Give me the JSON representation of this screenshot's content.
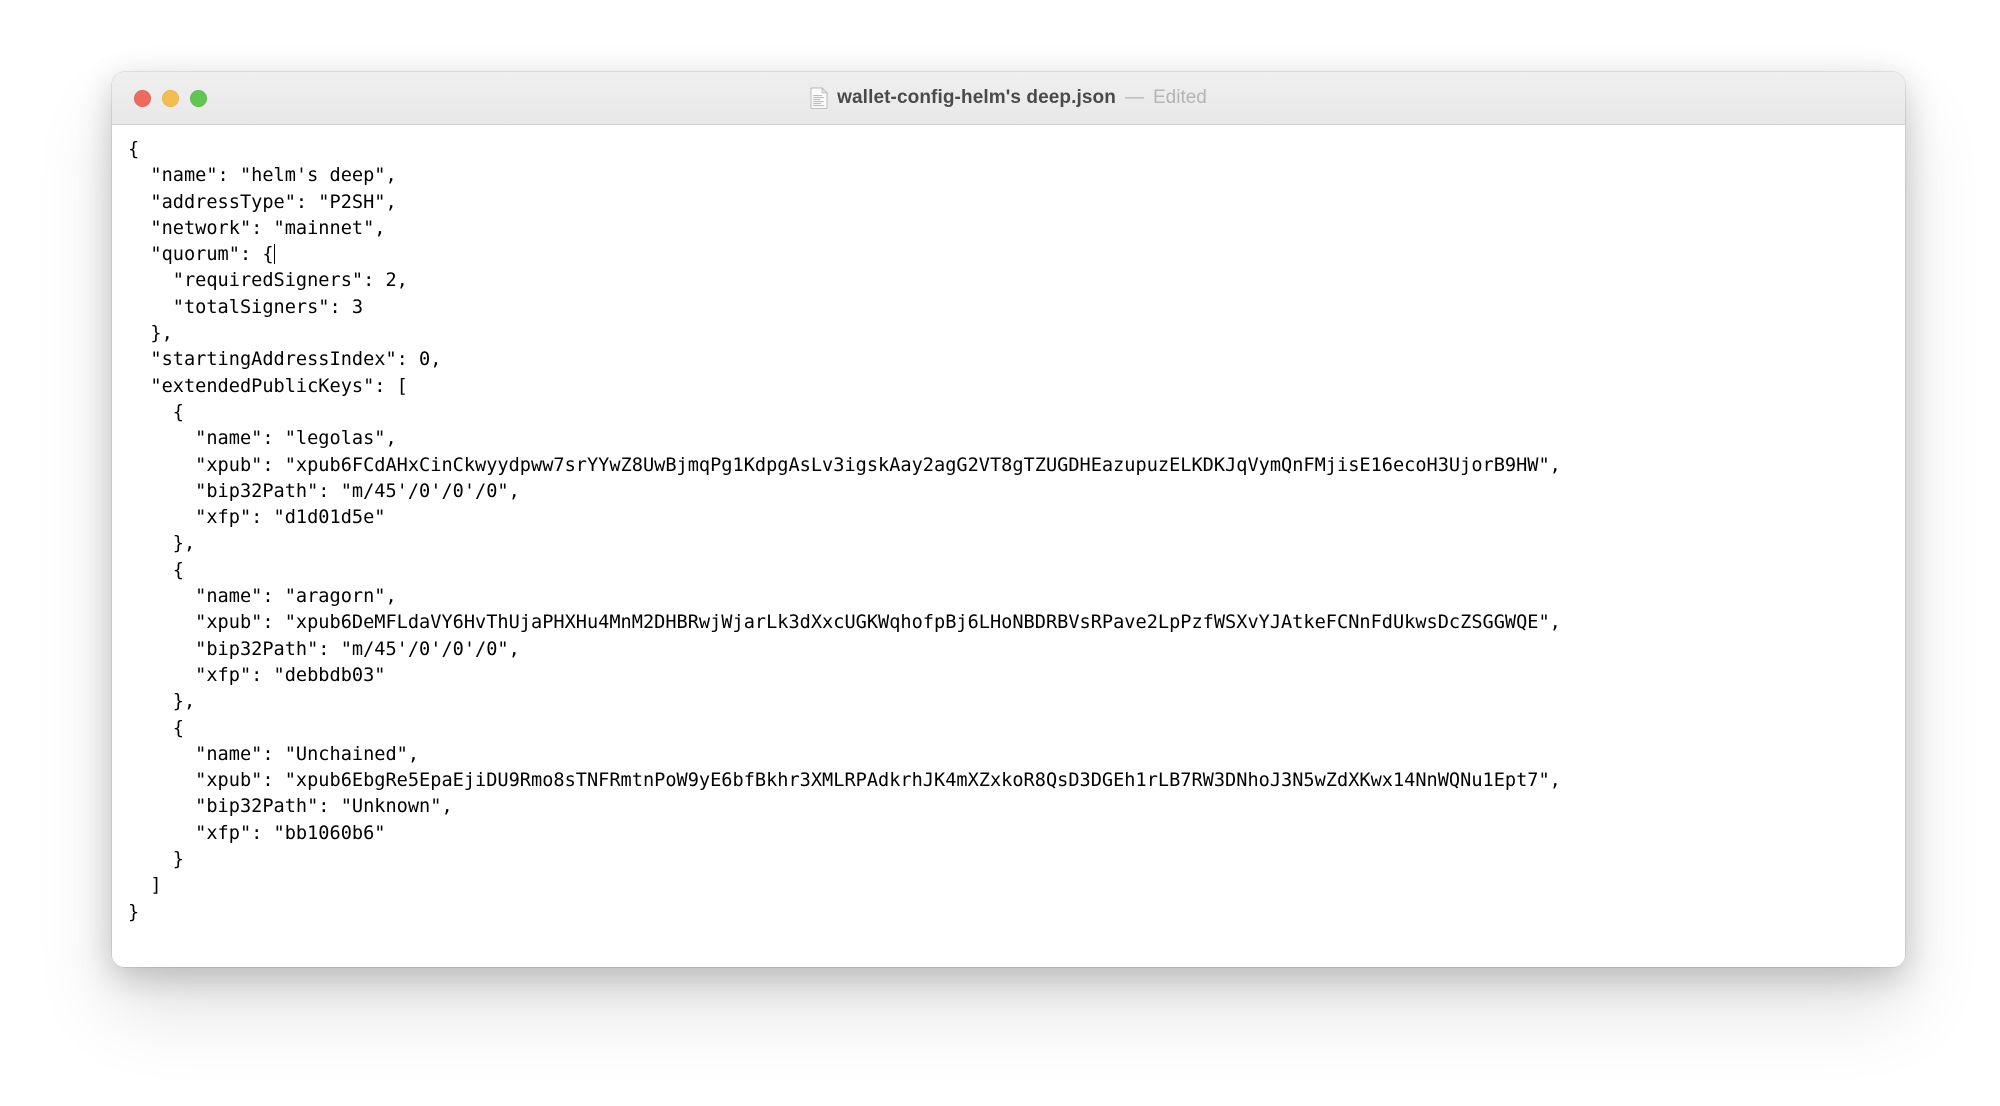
{
  "window": {
    "title_filename": "wallet-config-helm's deep.json",
    "title_separator": "—",
    "title_status": "Edited",
    "icon": "json-document-icon",
    "traffic_lights": [
      {
        "name": "close",
        "label": "Close",
        "color": "#ec6a5e"
      },
      {
        "name": "minimize",
        "label": "Minimize",
        "color": "#f4bd4f"
      },
      {
        "name": "maximize",
        "label": "Maximize",
        "color": "#61c554"
      }
    ]
  },
  "document": {
    "language": "json",
    "caret_line_index": 4,
    "lines": [
      "{",
      "  \"name\": \"helm's deep\",",
      "  \"addressType\": \"P2SH\",",
      "  \"network\": \"mainnet\",",
      "  \"quorum\": {",
      "    \"requiredSigners\": 2,",
      "    \"totalSigners\": 3",
      "  },",
      "  \"startingAddressIndex\": 0,",
      "  \"extendedPublicKeys\": [",
      "    {",
      "      \"name\": \"legolas\",",
      "      \"xpub\": \"xpub6FCdAHxCinCkwyydpww7srYYwZ8UwBjmqPg1KdpgAsLv3igskAay2agG2VT8gTZUGDHEazupuzELKDKJqVymQnFMjisE16ecoH3UjorB9HW\",",
      "      \"bip32Path\": \"m/45'/0'/0'/0\",",
      "      \"xfp\": \"d1d01d5e\"",
      "    },",
      "    {",
      "      \"name\": \"aragorn\",",
      "      \"xpub\": \"xpub6DeMFLdaVY6HvThUjaPHXHu4MnM2DHBRwjWjarLk3dXxcUGKWqhofpBj6LHoNBDRBVsRPave2LpPzfWSXvYJAtkeFCNnFdUkwsDcZSGGWQE\",",
      "      \"bip32Path\": \"m/45'/0'/0'/0\",",
      "      \"xfp\": \"debbdb03\"",
      "    },",
      "    {",
      "      \"name\": \"Unchained\",",
      "      \"xpub\": \"xpub6EbgRe5EpaEjiDU9Rmo8sTNFRmtnPoW9yE6bfBkhr3XMLRPAdkrhJK4mXZxkoR8QsD3DGEh1rLB7RW3DNhoJ3N5wZdXKwx14NnWQNu1Ept7\",",
      "      \"bip32Path\": \"Unknown\",",
      "      \"xfp\": \"bb1060b6\"",
      "    }",
      "  ]",
      "}"
    ],
    "parsed": {
      "name": "helm's deep",
      "addressType": "P2SH",
      "network": "mainnet",
      "quorum": {
        "requiredSigners": 2,
        "totalSigners": 3
      },
      "startingAddressIndex": 0,
      "extendedPublicKeys": [
        {
          "name": "legolas",
          "xpub": "xpub6FCdAHxCinCkwyydpww7srYYwZ8UwBjmqPg1KdpgAsLv3igskAay2agG2VT8gTZUGDHEazupuzELKDKJqVymQnFMjisE16ecoH3UjorB9HW",
          "bip32Path": "m/45'/0'/0'/0",
          "xfp": "d1d01d5e"
        },
        {
          "name": "aragorn",
          "xpub": "xpub6DeMFLdaVY6HvThUjaPHXHu4MnM2DHBRwjWjarLk3dXxcUGKWqhofpBj6LHoNBDRBVsRPave2LpPzfWSXvYJAtkeFCNnFdUkwsDcZSGGWQE",
          "bip32Path": "m/45'/0'/0'/0",
          "xfp": "debbdb03"
        },
        {
          "name": "Unchained",
          "xpub": "xpub6EbgRe5EpaEjiDU9Rmo8sTNFRmtnPoW9yE6bfBkhr3XMLRPAdkrhJK4mXZxkoR8QsD3DGEh1rLB7RW3DNhoJ3N5wZdXKwx14NnWQNu1Ept7",
          "bip32Path": "Unknown",
          "xfp": "bb1060b6"
        }
      ]
    }
  },
  "colors": {
    "desktop_background": "#ffffff",
    "window_background": "#ffffff",
    "titlebar_top": "#f0efef",
    "titlebar_bottom": "#e9e8e8",
    "text": "#000000",
    "title_text": "#4a4a4a",
    "title_muted": "#b4b4b4"
  }
}
